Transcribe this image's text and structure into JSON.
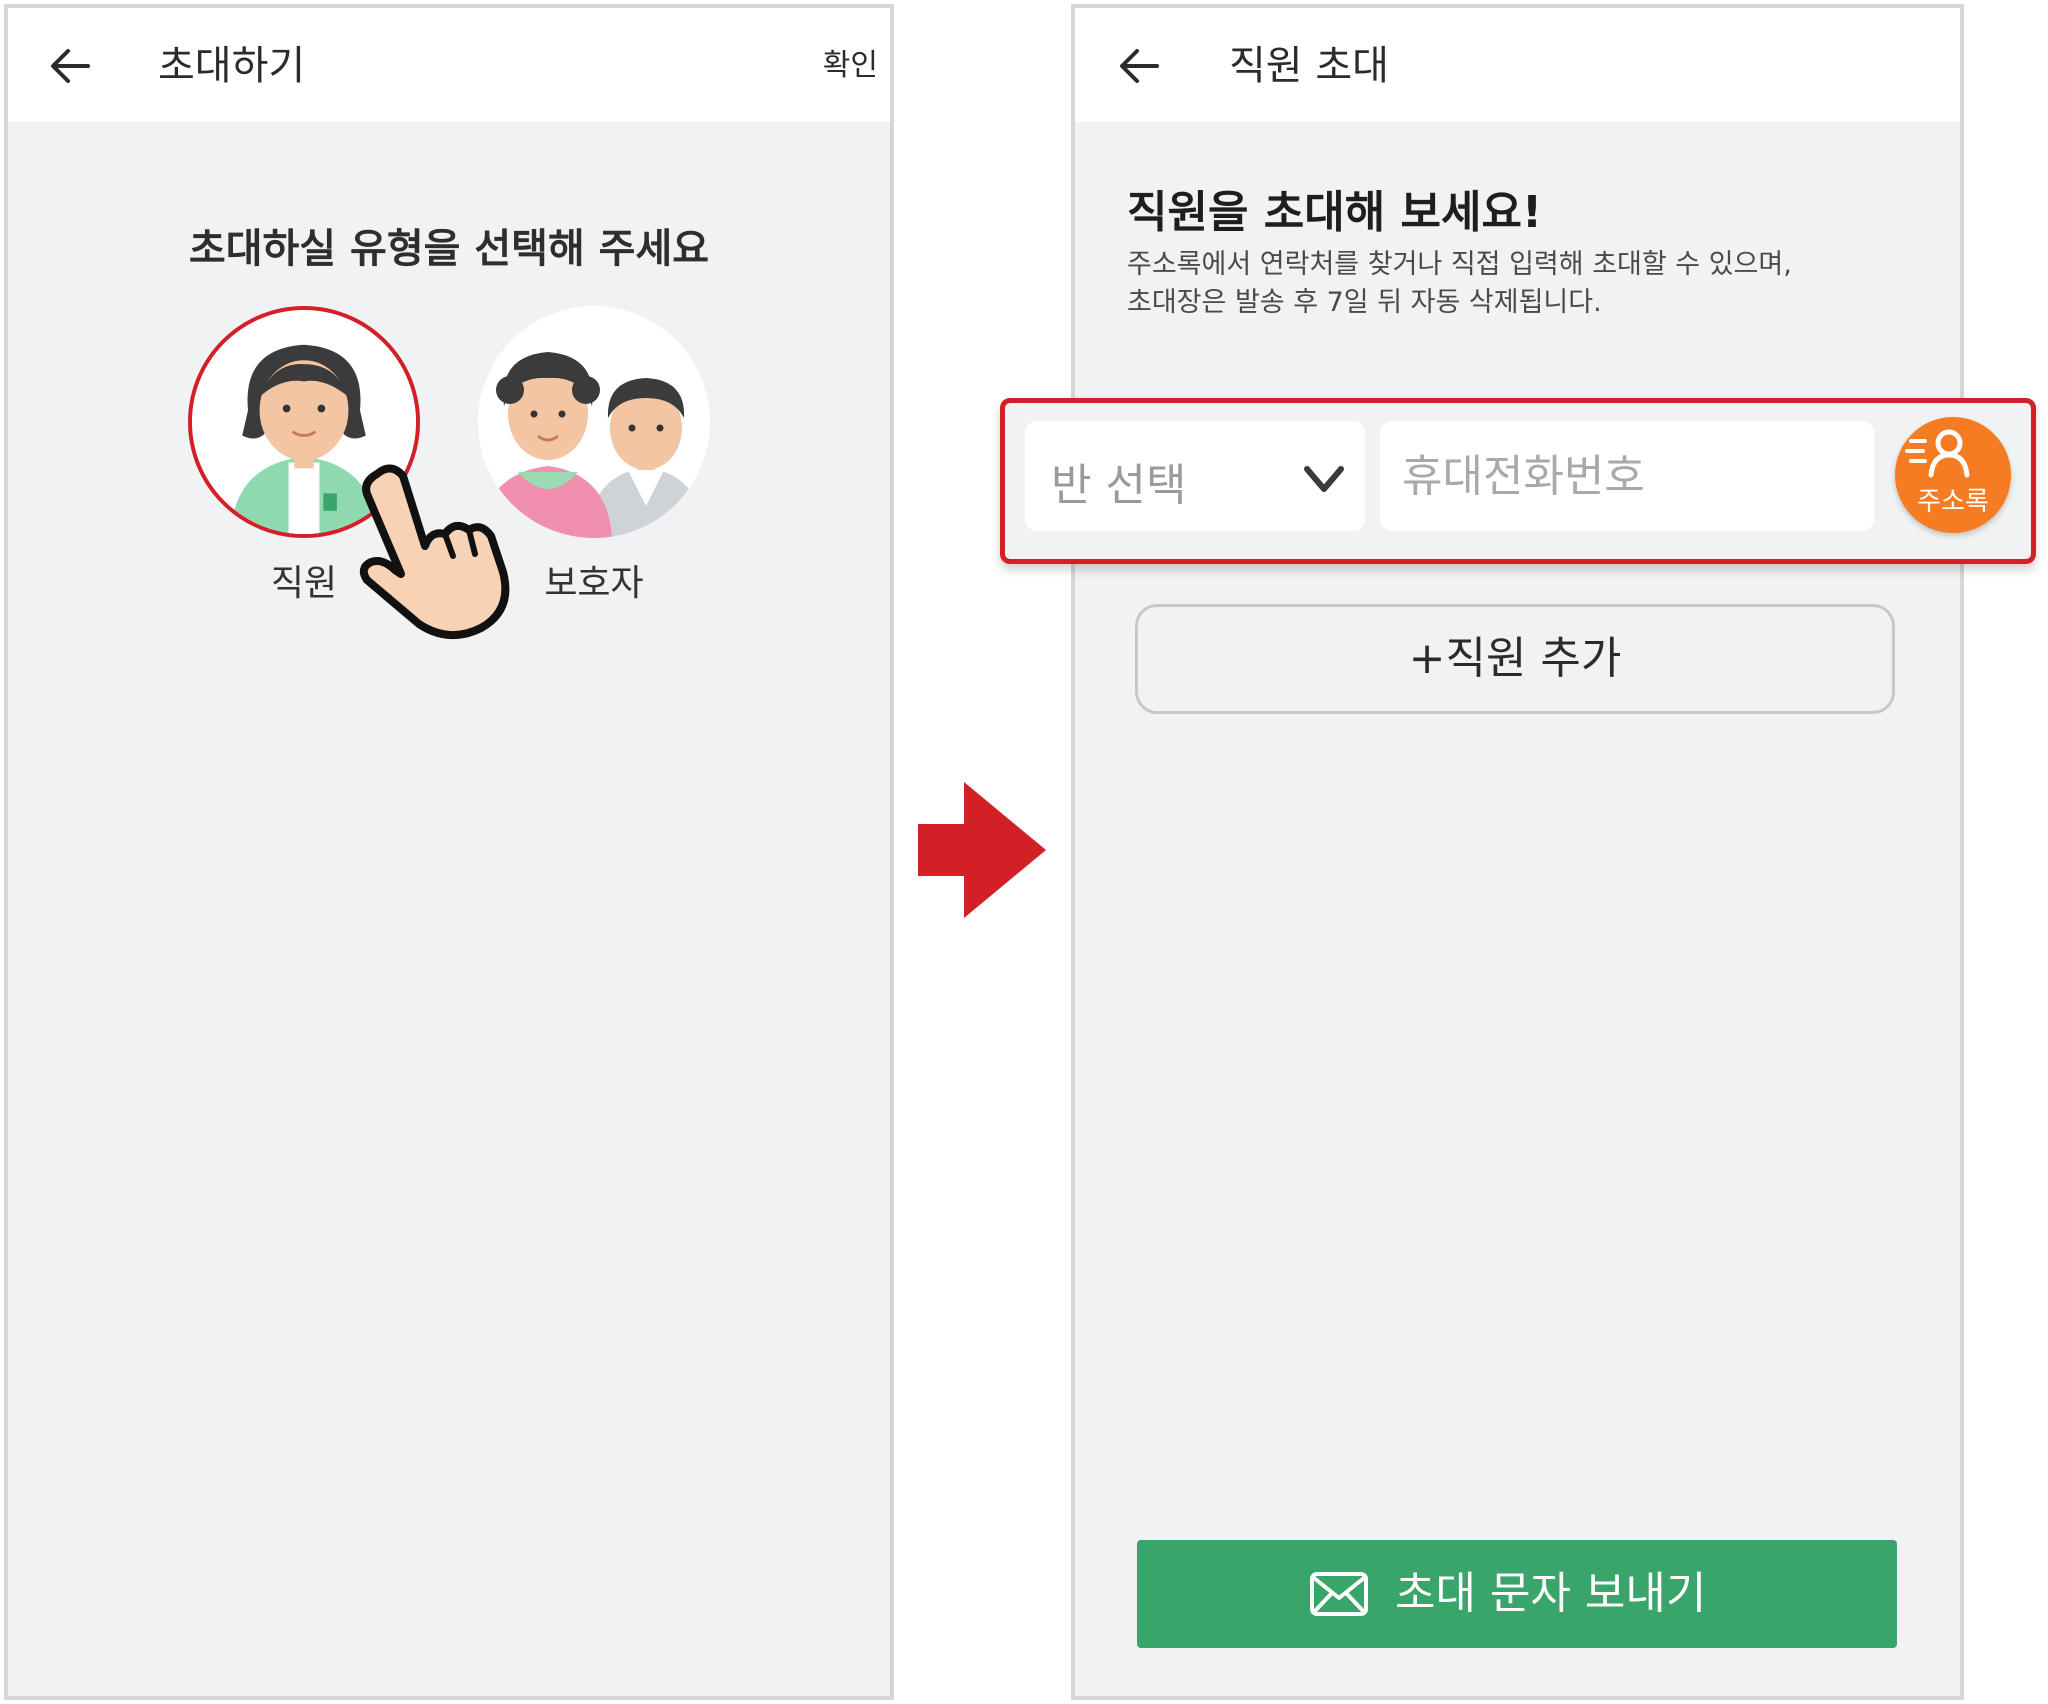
{
  "left_screen": {
    "header": {
      "title": "초대하기",
      "confirm_label": "확인"
    },
    "prompt": "초대하실 유형을 선택해 주세요",
    "options": [
      {
        "label": "직원",
        "selected": true
      },
      {
        "label": "보호자",
        "selected": false
      }
    ]
  },
  "right_screen": {
    "header": {
      "title": "직원 초대"
    },
    "heading": "직원을 초대해 보세요!",
    "description": [
      "주소록에서 연락처를 찾거나 직접 입력해 초대할 수 있으며,",
      "초대장은 발송 후 7일 뒤 자동 삭제됩니다."
    ],
    "class_select": {
      "label": "반 선택"
    },
    "phone": {
      "placeholder": "휴대전화번호",
      "value": ""
    },
    "address_book_label": "주소록",
    "add_staff_label": "+직원 추가",
    "send_label": "초대 문자 보내기"
  },
  "colors": {
    "accent_red": "#d32027",
    "send_green": "#3aa56a",
    "address_orange": "#f57c22",
    "background": "#f1f2f4"
  },
  "icons": [
    "back-arrow-icon",
    "pointer-hand-icon",
    "chevron-down-icon",
    "contacts-icon",
    "envelope-icon",
    "right-arrow-icon"
  ]
}
